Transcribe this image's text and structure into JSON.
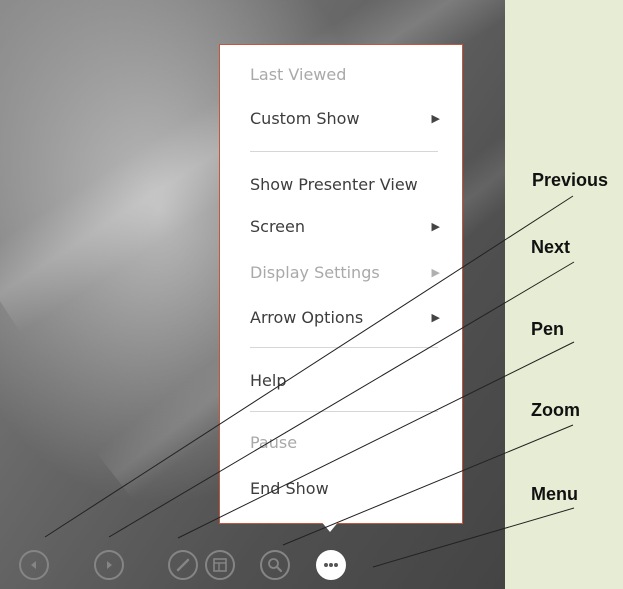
{
  "menu": {
    "items": [
      {
        "label": "Last Viewed",
        "disabled": true,
        "submenu": false
      },
      {
        "label": "Custom Show",
        "disabled": false,
        "submenu": true
      },
      {
        "label": "Show Presenter View",
        "disabled": false,
        "submenu": false
      },
      {
        "label": "Screen",
        "disabled": false,
        "submenu": true
      },
      {
        "label": "Display Settings",
        "disabled": true,
        "submenu": true
      },
      {
        "label": "Arrow Options",
        "disabled": false,
        "submenu": true
      },
      {
        "label": "Help",
        "disabled": false,
        "submenu": false
      },
      {
        "label": "Pause",
        "disabled": true,
        "submenu": false
      },
      {
        "label": "End Show",
        "disabled": false,
        "submenu": false
      }
    ],
    "submenu_glyph": "▶",
    "border_color": "#c0573f"
  },
  "controls": [
    {
      "name": "previous",
      "icon": "left-arrow-icon"
    },
    {
      "name": "next",
      "icon": "right-arrow-icon"
    },
    {
      "name": "pen",
      "icon": "pen-icon"
    },
    {
      "name": "see-all-slides",
      "icon": "slides-icon"
    },
    {
      "name": "zoom",
      "icon": "magnifier-icon"
    },
    {
      "name": "menu",
      "icon": "more-icon"
    }
  ],
  "callouts": {
    "previous": "Previous",
    "next": "Next",
    "pen": "Pen",
    "zoom": "Zoom",
    "menu": "Menu"
  },
  "colors": {
    "background": "#e6edd4",
    "menu_border": "#c0573f"
  }
}
